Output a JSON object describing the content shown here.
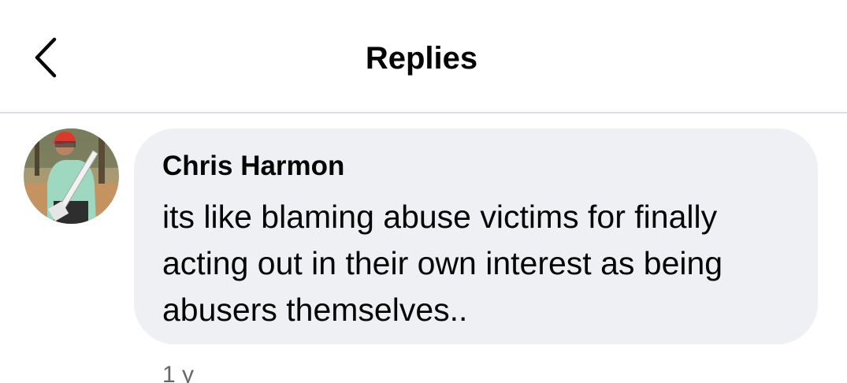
{
  "header": {
    "back_icon": "chevron-left-icon",
    "title": "Replies"
  },
  "reply": {
    "author": "Chris Harmon",
    "text": "its like blaming abuse victims for finally acting out in their own interest as being abusers themselves..",
    "timestamp": "1 y",
    "avatar_icon": "profile-photo"
  },
  "colors": {
    "background": "#ffffff",
    "bubble": "#eff0f4",
    "text_primary": "#050505",
    "text_secondary": "#65676b",
    "divider": "#dcdde1"
  }
}
